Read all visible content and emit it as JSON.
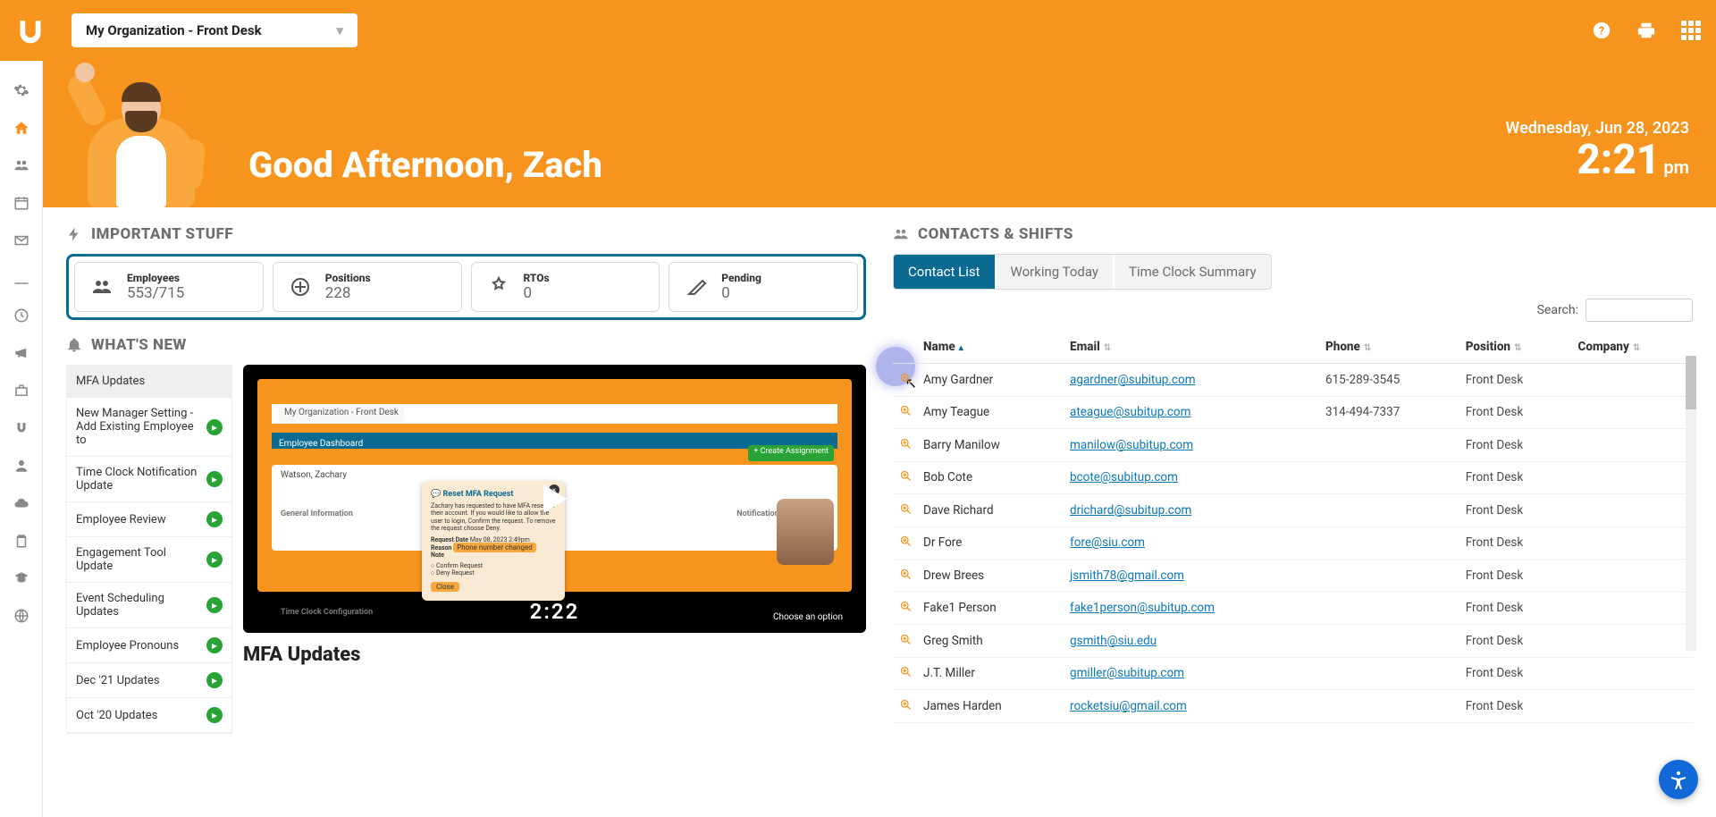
{
  "org_select": {
    "label": "My Organization - Front Desk"
  },
  "greeting": "Good Afternoon, Zach",
  "date": "Wednesday, Jun 28, 2023",
  "time": "2:21",
  "ampm": "pm",
  "sections": {
    "important": "IMPORTANT STUFF",
    "whatsnew": "WHAT'S NEW",
    "contacts": "CONTACTS & SHIFTS"
  },
  "stats": {
    "employees": {
      "label": "Employees",
      "value": "553/715"
    },
    "positions": {
      "label": "Positions",
      "value": "228"
    },
    "rtos": {
      "label": "RTOs",
      "value": "0"
    },
    "pending": {
      "label": "Pending",
      "value": "0"
    }
  },
  "whats_new": [
    "MFA Updates",
    "New Manager Setting - Add Existing Employee to",
    "Time Clock Notification Update",
    "Employee Review",
    "Engagement Tool Update",
    "Event Scheduling Updates",
    "Employee Pronouns",
    "Dec '21 Updates",
    "Oct '20 Updates"
  ],
  "wn_article_title": "MFA Updates",
  "video": {
    "org_label": "My Organization - Front Desk",
    "dashboard": "Employee Dashboard",
    "name_row": "Watson, Zachary",
    "btn": "+ Create Assignment",
    "modal_title": "Reset MFA Request",
    "modal_body": "Zachary has requested to have MFA reset for their account. If you would like to allow the user to login, Confirm the request. To remove the request choose Deny.",
    "modal_date_lbl": "Request Date",
    "modal_date": "May 08, 2023 2:49pm",
    "modal_reason_lbl": "Reason",
    "modal_reason": "Phone number changed",
    "modal_note_lbl": "Note",
    "modal_opt1": "Confirm Request",
    "modal_opt2": "Deny Request",
    "modal_close": "Close",
    "choose": "Choose an option",
    "time": "2:22",
    "sidebar_gi": "General Information",
    "sidebar_np": "Notification Preferences",
    "sidebar_tcc": "Time Clock Configuration"
  },
  "tabs": {
    "contact": "Contact List",
    "working": "Working Today",
    "tcs": "Time Clock Summary"
  },
  "search_label": "Search:",
  "columns": {
    "name": "Name",
    "email": "Email",
    "phone": "Phone",
    "position": "Position",
    "company": "Company"
  },
  "contacts": [
    {
      "name": "Amy Gardner",
      "email": "agardner@subitup.com",
      "phone": "615-289-3545",
      "position": "Front Desk"
    },
    {
      "name": "Amy Teague",
      "email": "ateague@subitup.com",
      "phone": "314-494-7337",
      "position": "Front Desk"
    },
    {
      "name": "Barry Manilow",
      "email": "manilow@subitup.com",
      "phone": "",
      "position": "Front Desk"
    },
    {
      "name": "Bob Cote",
      "email": "bcote@subitup.com",
      "phone": "",
      "position": "Front Desk"
    },
    {
      "name": "Dave Richard",
      "email": "drichard@subitup.com",
      "phone": "",
      "position": "Front Desk"
    },
    {
      "name": "Dr Fore",
      "email": "fore@siu.com",
      "phone": "",
      "position": "Front Desk"
    },
    {
      "name": "Drew Brees",
      "email": "jsmith78@gmail.com",
      "phone": "",
      "position": "Front Desk"
    },
    {
      "name": "Fake1 Person",
      "email": "fake1person@subitup.com",
      "phone": "",
      "position": "Front Desk"
    },
    {
      "name": "Greg Smith",
      "email": "gsmith@siu.edu",
      "phone": "",
      "position": "Front Desk"
    },
    {
      "name": "J.T. Miller",
      "email": "gmiller@subitup.com",
      "phone": "",
      "position": "Front Desk"
    },
    {
      "name": "James Harden",
      "email": "rocketsiu@gmail.com",
      "phone": "",
      "position": "Front Desk"
    }
  ]
}
